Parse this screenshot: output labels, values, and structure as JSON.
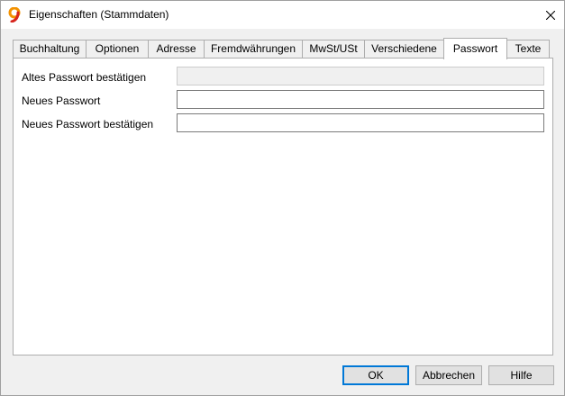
{
  "window": {
    "title": "Eigenschaften (Stammdaten)",
    "app_icon": "app-logo-icon",
    "close_icon": "close-icon"
  },
  "tabs": [
    {
      "label": "Buchhaltung",
      "active": false
    },
    {
      "label": "Optionen",
      "active": false
    },
    {
      "label": "Adresse",
      "active": false
    },
    {
      "label": "Fremdwährungen",
      "active": false
    },
    {
      "label": "MwSt/USt",
      "active": false
    },
    {
      "label": "Verschiedene",
      "active": false
    },
    {
      "label": "Passwort",
      "active": true
    },
    {
      "label": "Texte",
      "active": false
    }
  ],
  "password": {
    "old_label": "Altes Passwort bestätigen",
    "old_value": "",
    "new_label": "Neues Passwort",
    "new_value": "",
    "confirm_label": "Neues Passwort bestätigen",
    "confirm_value": ""
  },
  "buttons": {
    "ok": "OK",
    "cancel": "Abbrechen",
    "help": "Hilfe"
  },
  "colors": {
    "accent": "#0078d7",
    "logo_orange": "#f39200",
    "logo_red": "#d7261e"
  }
}
